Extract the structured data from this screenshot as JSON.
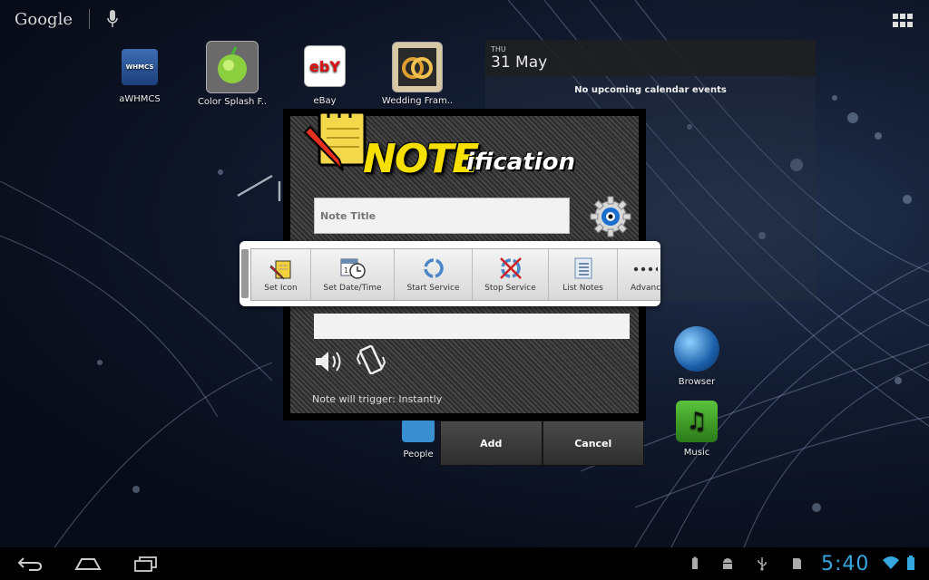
{
  "search": {
    "logo": "Google"
  },
  "desktop_icons": [
    {
      "label": "aWHMCS",
      "badge": "WHMCS"
    },
    {
      "label": "Color Splash F.."
    },
    {
      "label": "eBay",
      "badge": "ebY"
    },
    {
      "label": "Wedding Fram.."
    },
    {
      "label": "People"
    },
    {
      "label": "Browser"
    },
    {
      "label": "Music"
    }
  ],
  "calendar": {
    "day_of_week": "THU",
    "date": "31 May",
    "empty": "No upcoming calendar events"
  },
  "dialog": {
    "title_main": "NOTE",
    "title_suffix": "ification",
    "note_title_placeholder": "Note Title",
    "trigger_text": "Note will trigger: Instantly",
    "add_label": "Add",
    "cancel_label": "Cancel"
  },
  "menu": [
    {
      "label": "Set Icon",
      "icon": "notepad-icon"
    },
    {
      "label": "Set Date/Time",
      "icon": "calendar-clock-icon"
    },
    {
      "label": "Start Service",
      "icon": "refresh-icon"
    },
    {
      "label": "Stop Service",
      "icon": "stop-service-icon"
    },
    {
      "label": "List Notes",
      "icon": "list-icon"
    },
    {
      "label": "Advanc",
      "icon": "more-icon"
    }
  ],
  "status": {
    "time": "5:40"
  },
  "colors": {
    "accent_yellow": "#f6e000",
    "clock_blue": "#36a8e0"
  }
}
